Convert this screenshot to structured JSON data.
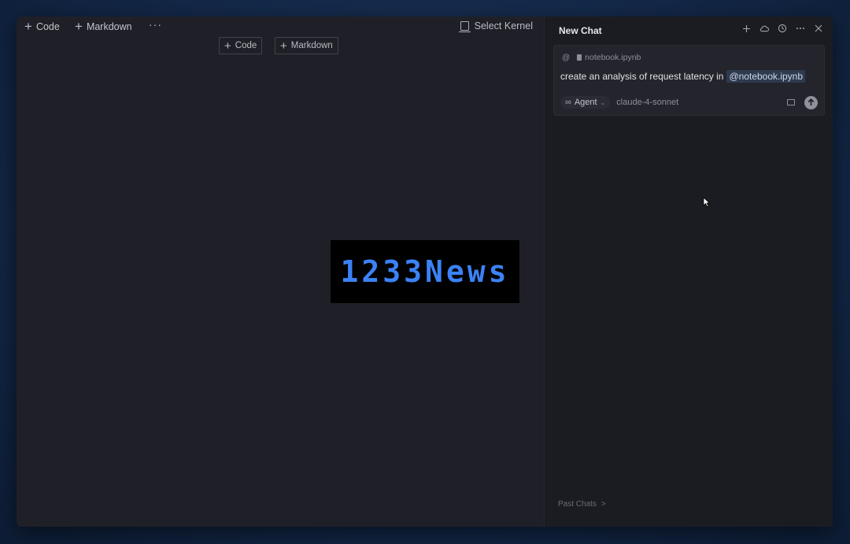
{
  "toolbar": {
    "code_label": "Code",
    "markdown_label": "Markdown",
    "more_label": "···",
    "kernel_label": "Select Kernel"
  },
  "cell_actions": {
    "code_label": "Code",
    "markdown_label": "Markdown"
  },
  "logo": {
    "text": "1233News",
    "color": "#3b82f6"
  },
  "chat": {
    "title": "New Chat",
    "header_icons": [
      "plus-icon",
      "cloud-icon",
      "history-icon",
      "more-icon",
      "close-icon"
    ],
    "context_at": "@",
    "context_file": "notebook.ipynb",
    "prompt_text": "create an analysis of request latency in",
    "prompt_mention": "@notebook.ipynb",
    "mode_label": "Agent",
    "model_name": "claude-4-sonnet",
    "past_chats_label": "Past Chats",
    "past_chats_arrow": ">"
  },
  "colors": {
    "window_bg": "#1f2027",
    "chat_bg": "#1b1c22",
    "accent": "#3b82f6"
  }
}
